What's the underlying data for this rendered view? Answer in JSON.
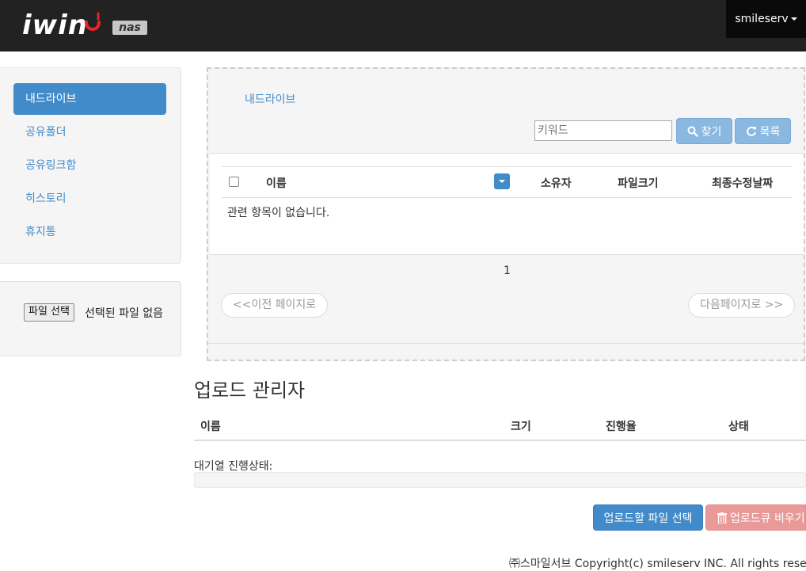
{
  "header": {
    "logo_text": "iwin",
    "badge": "nas",
    "user": "smileserv"
  },
  "sidebar": {
    "items": [
      {
        "label": "내드라이브",
        "active": true
      },
      {
        "label": "공유폴더"
      },
      {
        "label": "공유링크함"
      },
      {
        "label": "히스토리"
      },
      {
        "label": "휴지통"
      }
    ]
  },
  "file_input": {
    "button_label": "파일 선택",
    "status": "선택된 파일 없음"
  },
  "main": {
    "breadcrumb": "내드라이브",
    "search": {
      "placeholder": "키워드",
      "value": ""
    },
    "find_label": "찾기",
    "list_label": "목록",
    "table": {
      "columns": [
        "이름",
        "소유자",
        "파일크기",
        "최종수정날짜"
      ],
      "empty_message": "관련 항목이 없습니다."
    },
    "pagination": {
      "page": "1",
      "prev_label": "<<이전 페이지로",
      "next_label": "다음페이지로 >>"
    }
  },
  "upload_manager": {
    "title": "업로드 관리자",
    "columns": [
      "이름",
      "크기",
      "진행율",
      "상태"
    ],
    "queue_label": "대기열 진행상태:",
    "queue_progress": 0,
    "select_button": "업로드할 파일 선택",
    "clear_button": "업로드큐 비우기"
  },
  "footer": "㈜스마일서브 Copyright(c) smileserv INC. All rights reserved."
}
